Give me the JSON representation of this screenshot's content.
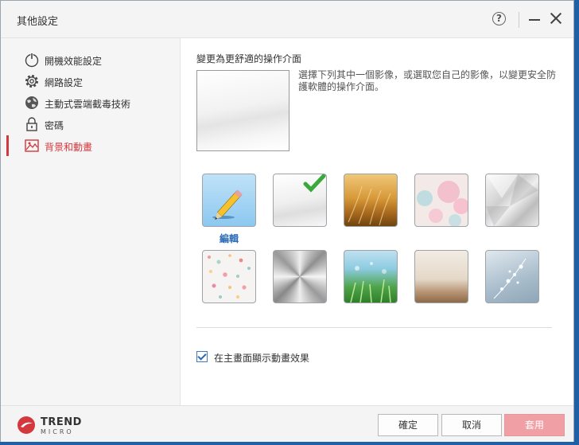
{
  "window": {
    "title": "其他設定",
    "help_glyph": "?"
  },
  "sidebar": {
    "items": [
      {
        "label": "開機效能設定",
        "icon": "power-icon"
      },
      {
        "label": "網路設定",
        "icon": "gear-icon"
      },
      {
        "label": "主動式雲端截毒技術",
        "icon": "globe-icon"
      },
      {
        "label": "密碼",
        "icon": "lock-icon"
      },
      {
        "label": "背景和動畫",
        "icon": "image-icon",
        "active": true
      }
    ]
  },
  "main": {
    "section_title": "變更為更舒適的操作介面",
    "description": "選擇下列其中一個影像，或選取您自己的影像，以變更安全防護軟體的操作介面。",
    "edit_label": "編輯",
    "animation_checkbox": {
      "label": "在主畫面顯示動畫效果",
      "checked": true
    }
  },
  "footer": {
    "logo_line1": "TREND",
    "logo_line2": "MICRO",
    "ok_label": "確定",
    "cancel_label": "取消",
    "apply_label": "套用"
  },
  "colors": {
    "accent": "#d4383e",
    "link": "#2a6ab8",
    "apply_disabled": "#f0a0a4"
  }
}
